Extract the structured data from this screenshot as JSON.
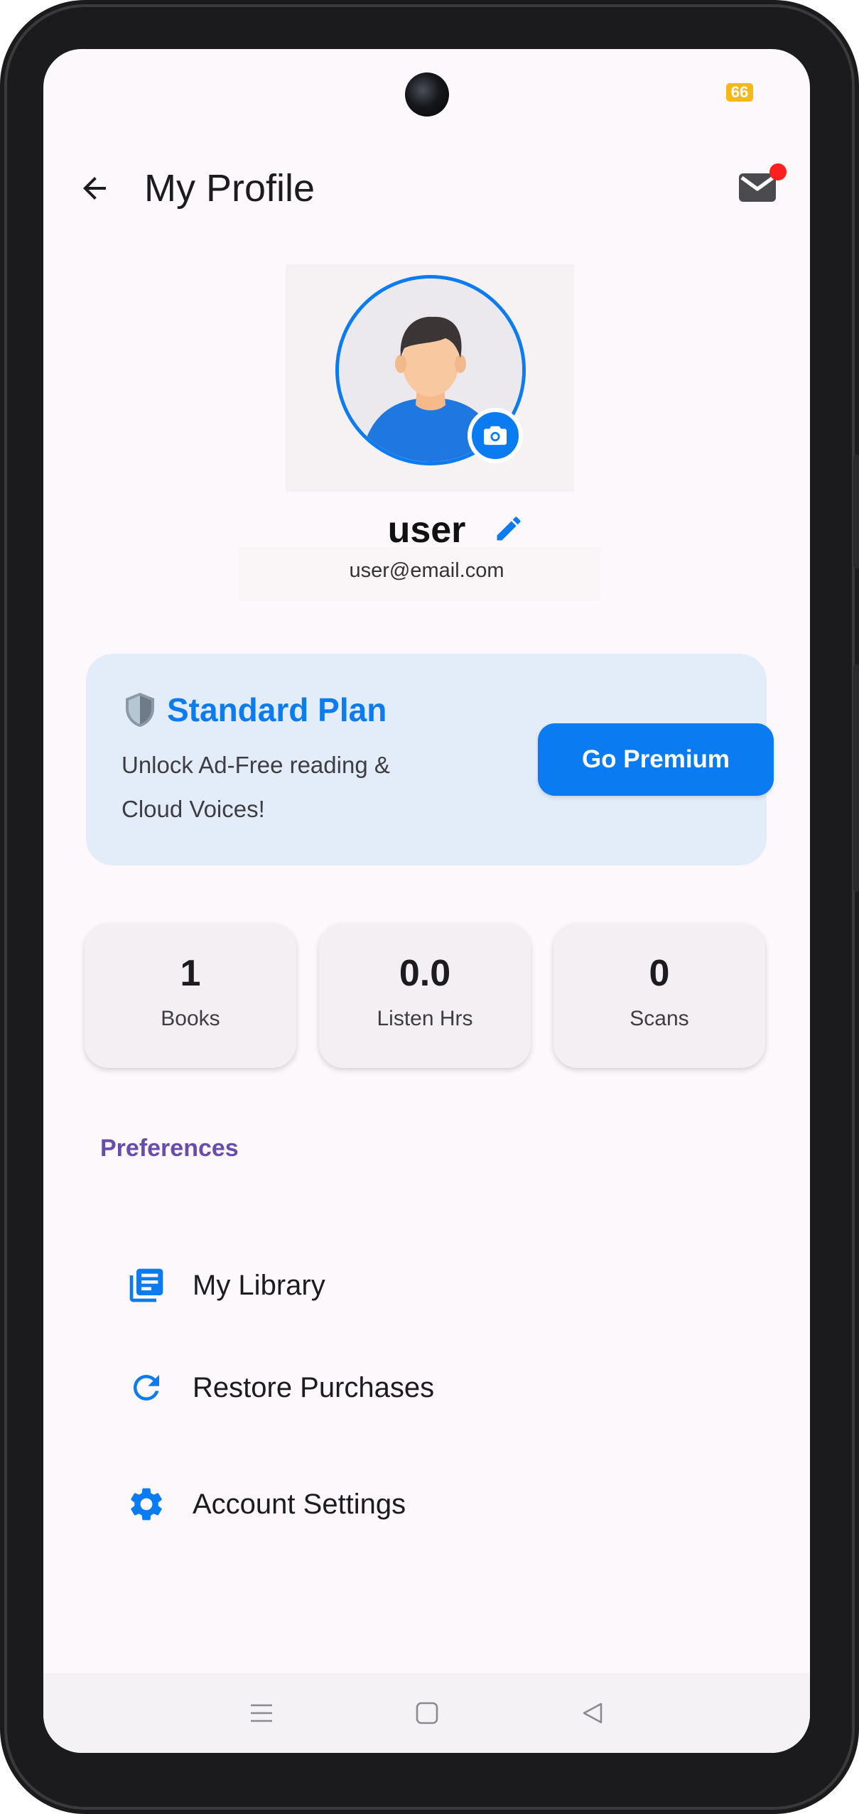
{
  "status_bar": {
    "battery": "66"
  },
  "header": {
    "title": "My Profile"
  },
  "profile": {
    "username": "user",
    "email": "user@email.com"
  },
  "plan": {
    "title": "Standard Plan",
    "description": "Unlock Ad-Free reading & Cloud Voices!",
    "button_label": "Go Premium"
  },
  "stats": [
    {
      "value": "1",
      "label": "Books"
    },
    {
      "value": "0.0",
      "label": "Listen Hrs"
    },
    {
      "value": "0",
      "label": "Scans"
    }
  ],
  "preferences": {
    "title": "Preferences",
    "items": [
      {
        "label": "My Library",
        "icon": "library-icon"
      },
      {
        "label": "Restore Purchases",
        "icon": "refresh-icon"
      },
      {
        "label": "Account Settings",
        "icon": "gear-icon"
      }
    ]
  },
  "colors": {
    "accent": "#0a7bf0",
    "section": "#6a4da8",
    "notification": "#ff1f1f"
  }
}
